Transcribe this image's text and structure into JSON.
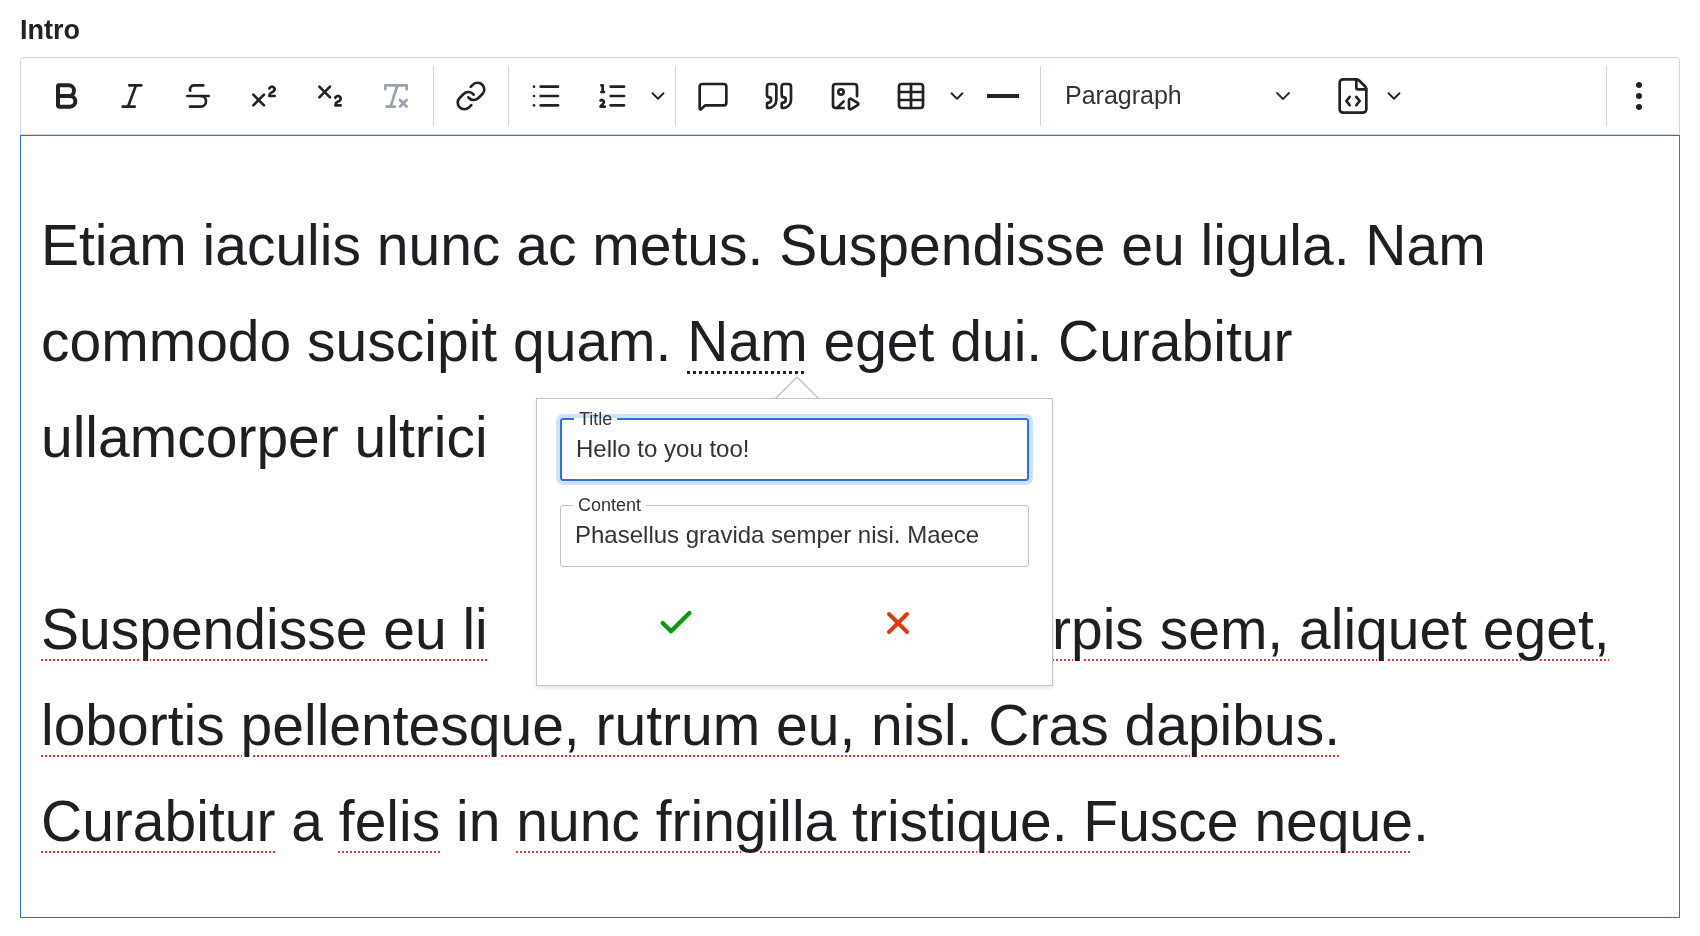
{
  "label": "Intro",
  "toolbar": {
    "groups": [
      [
        {
          "kind": "bold",
          "disabled": false
        },
        {
          "kind": "italic",
          "disabled": false
        },
        {
          "kind": "strikethrough",
          "disabled": false
        },
        {
          "kind": "superscript",
          "disabled": false
        },
        {
          "kind": "subscript",
          "disabled": false
        },
        {
          "kind": "remove-format",
          "disabled": true
        }
      ],
      [
        {
          "kind": "link",
          "disabled": false
        }
      ],
      [
        {
          "kind": "bulleted-list",
          "disabled": false
        },
        {
          "kind": "numbered-list",
          "disabled": false,
          "dropdown": true
        }
      ],
      [
        {
          "kind": "comment",
          "disabled": false
        },
        {
          "kind": "quote",
          "disabled": false
        },
        {
          "kind": "media",
          "disabled": false
        },
        {
          "kind": "table",
          "disabled": false,
          "dropdown": true
        },
        {
          "kind": "horizontal-line",
          "disabled": false
        }
      ]
    ],
    "heading_select": "Paragraph",
    "source": {
      "dropdown": true
    }
  },
  "editor": {
    "focused": true,
    "paragraphs": [
      {
        "lines": [
          {
            "left": [
              {
                "text": "Etiam iaculis nunc ac metus. Suspendisse eu ligula. Nam",
                "kind": "plain"
              }
            ]
          },
          {
            "left": [
              {
                "text": "commodo suscipit quam. ",
                "kind": "plain"
              },
              {
                "text": "Nam",
                "kind": "annotation"
              },
              {
                "text": " eget dui. Curabitur",
                "kind": "plain"
              }
            ]
          },
          {
            "left": [
              {
                "text": "ullamcorper ultrici",
                "kind": "plain"
              }
            ]
          }
        ]
      },
      {
        "lines": [
          {
            "left": [
              {
                "text": "Suspendisse eu li",
                "kind": "misspelled"
              }
            ],
            "right": [
              {
                "text": "rpis sem, aliquet eget,",
                "kind": "misspelled"
              }
            ]
          },
          {
            "left": [
              {
                "text": "lobortis pellentesque, rutrum eu, nisl. Cras dapibus.",
                "kind": "misspelled"
              }
            ]
          },
          {
            "left": [
              {
                "text": "Curabitur",
                "kind": "misspelled"
              },
              {
                "text": " a ",
                "kind": "plain"
              },
              {
                "text": "felis",
                "kind": "misspelled"
              },
              {
                "text": " in ",
                "kind": "plain"
              },
              {
                "text": "nunc fringilla tristique. Fusce neque",
                "kind": "misspelled"
              },
              {
                "text": ".",
                "kind": "plain"
              }
            ]
          }
        ]
      }
    ]
  },
  "popup": {
    "fields": [
      {
        "label": "Title",
        "value": "Hello to you too!",
        "focused": true
      },
      {
        "label": "Content",
        "value": "Phasellus gravida semper nisi. Maece",
        "focused": false
      }
    ]
  }
}
